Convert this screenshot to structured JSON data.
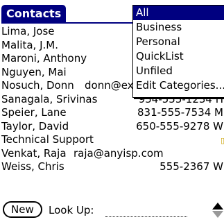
{
  "app": {
    "title": "Contacts"
  },
  "contacts": [
    {
      "name": "Lima, Jose",
      "info": ""
    },
    {
      "name": "Malita, J.M.",
      "info": ""
    },
    {
      "name": "Maroni, Anthony",
      "info": ""
    },
    {
      "name": "Nguyen, Mai",
      "info": ""
    },
    {
      "name": "Nosuch, Donn",
      "info": "donn@example.com"
    },
    {
      "name": "Sanagala, Srivinas",
      "info": "954-555-1234 H"
    },
    {
      "name": "Speier, Lane",
      "info": "831-555-7534 M"
    },
    {
      "name": "Taylor, David",
      "info": "650-555-9278 W"
    },
    {
      "name": "Technical Support",
      "info": ""
    },
    {
      "name": "Venkat, Raja",
      "info": "raja@anyisp.com"
    },
    {
      "name": "Weiss, Chris",
      "info": "555-2367 W"
    }
  ],
  "category_popup": {
    "options": [
      "All",
      "Business",
      "Personal",
      "QuickList",
      "Unfiled",
      "Edit Categories..."
    ],
    "selected": "All"
  },
  "bottom_bar": {
    "new_label": "New",
    "lookup_label": "Look Up:",
    "lookup_value": ""
  },
  "colors": {
    "accent": "#000080",
    "marker": "#c8a000"
  }
}
